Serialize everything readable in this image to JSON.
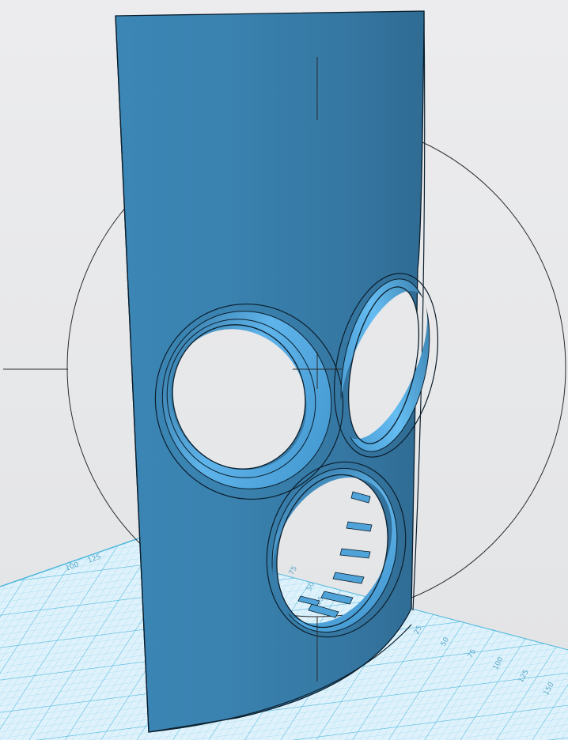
{
  "app": {
    "view": "3D modeling viewport"
  },
  "grid": {
    "color": "#4fb8dd",
    "axis_labels": [
      "25",
      "50",
      "75",
      "100",
      "125",
      "150",
      "175"
    ],
    "side_labels": [
      "125",
      "100",
      "75",
      "50",
      "25"
    ]
  },
  "model": {
    "name": "curved panel with three circular cutouts",
    "color": "#3a84b4",
    "edge_color": "#0b1e2c"
  },
  "manipulator": {
    "type": "rotate gizmo",
    "color": "#2b2b2b"
  },
  "icons": {
    "rotate_ring": "rotate-ring-icon",
    "center_crosshair": "crosshair-icon"
  }
}
